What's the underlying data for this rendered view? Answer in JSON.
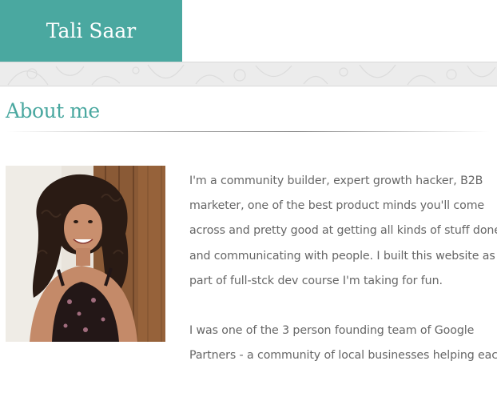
{
  "header": {
    "brand": "Tali Saar"
  },
  "about": {
    "title": "About me",
    "paragraph1_lines": [
      "I'm a community builder, expert growth hacker, B2B",
      "marketer, one of the best product minds you'll come",
      "across and pretty good at getting all kinds of stuff done",
      "and communicating with people. I built this website as",
      "part of full-stck dev course I'm taking for fun."
    ],
    "paragraph2_lines": [
      "I was one of the 3 person founding team of Google",
      "Partners - a community of local businesses helping each"
    ]
  },
  "colors": {
    "accent": "#4aa8a0",
    "body_text": "#666666",
    "band": "#ececec"
  }
}
